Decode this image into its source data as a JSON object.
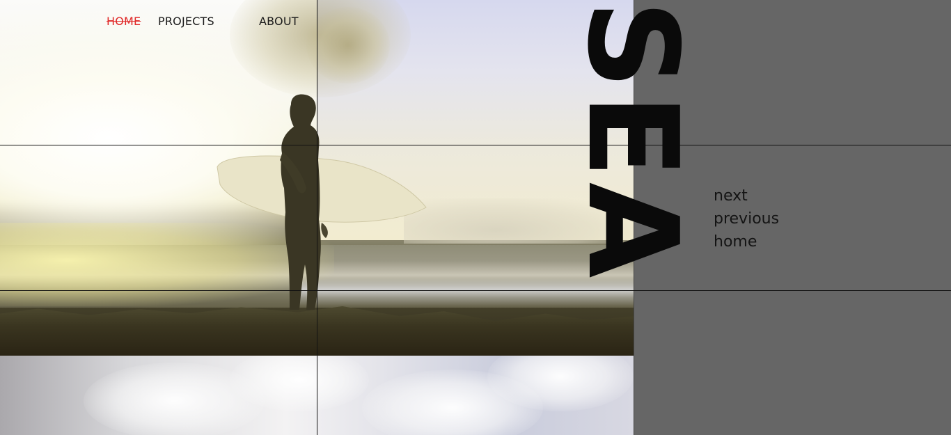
{
  "nav": {
    "home_label": "HOME",
    "projects_label": "PROJECTS",
    "about_label": "ABOUT",
    "active_item": "home",
    "active_color": "#e02828"
  },
  "hero": {
    "title": "SEA",
    "panel_color": "#666666"
  },
  "side_menu": {
    "next_label": "next",
    "previous_label": "previous",
    "home_label": "home"
  }
}
